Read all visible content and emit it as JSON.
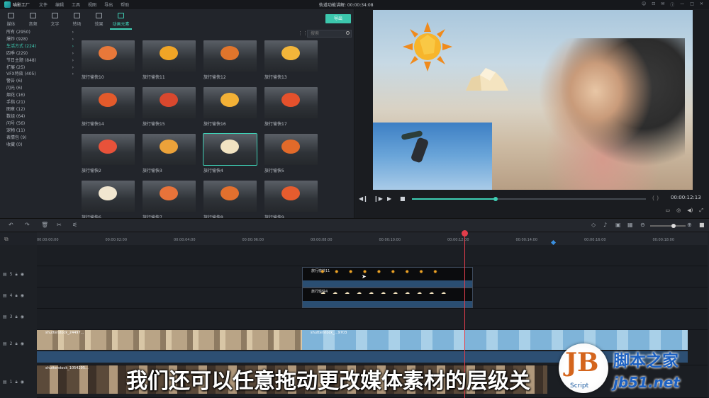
{
  "app": {
    "name": "喵影工厂",
    "title": "轨道功能讲解: 00:00:34:08"
  },
  "menu": [
    "文件",
    "编辑",
    "工具",
    "视图",
    "导出",
    "帮助"
  ],
  "media_tabs": [
    {
      "label": "媒体"
    },
    {
      "label": "音频"
    },
    {
      "label": "文字"
    },
    {
      "label": "转场"
    },
    {
      "label": "效果"
    },
    {
      "label": "动画元素"
    }
  ],
  "export_label": "导出",
  "search_placeholder": "搜索",
  "categories": [
    {
      "label": "所有 (2950)"
    },
    {
      "label": "爆炸 (928)"
    },
    {
      "label": "生活方式 (224)"
    },
    {
      "label": "四季 (229)"
    },
    {
      "label": "节日主题 (848)"
    },
    {
      "label": "扩展 (25)"
    },
    {
      "label": "VFX特效 (405)"
    },
    {
      "label": "警告 (6)"
    },
    {
      "label": "闪光 (6)"
    },
    {
      "label": "烟花 (16)"
    },
    {
      "label": "手指 (21)"
    },
    {
      "label": "图章 (12)"
    },
    {
      "label": "数组 (64)"
    },
    {
      "label": "问号 (56)"
    },
    {
      "label": "宠物 (11)"
    },
    {
      "label": "表情包 (9)"
    },
    {
      "label": "收藏 (0)"
    }
  ],
  "thumbnails": [
    {
      "label": "旅行愉快10",
      "color": "#e8783a"
    },
    {
      "label": "旅行愉快11",
      "color": "#f0a526"
    },
    {
      "label": "旅行愉快12",
      "color": "#e0752c"
    },
    {
      "label": "旅行愉快13",
      "color": "#f2b53a"
    },
    {
      "label": "旅行愉快14",
      "color": "#e35a2b"
    },
    {
      "label": "旅行愉快15",
      "color": "#d9482e"
    },
    {
      "label": "旅行愉快16",
      "color": "#f3b136"
    },
    {
      "label": "旅行愉快17",
      "color": "#e5512c"
    },
    {
      "label": "旅行愉快2",
      "color": "#e8523a"
    },
    {
      "label": "旅行愉快3",
      "color": "#eca23a"
    },
    {
      "label": "旅行愉快4",
      "color": "#f1e3c2"
    },
    {
      "label": "旅行愉快5",
      "color": "#e26a2a"
    },
    {
      "label": "旅行愉快6",
      "color": "#f1e6d0"
    },
    {
      "label": "旅行愉快7",
      "color": "#e8733a"
    },
    {
      "label": "旅行愉快8",
      "color": "#e3702e"
    },
    {
      "label": "旅行愉快9",
      "color": "#e65c2e"
    }
  ],
  "preview": {
    "timecode": "00:00:12:13"
  },
  "ruler_ticks": [
    "00:00:00:00",
    "00:00:02:00",
    "00:00:04:00",
    "00:00:06:00",
    "00:00:08:00",
    "00:00:10:00",
    "00:00:12:00",
    "00:00:14:00",
    "00:00:16:00",
    "00:00:18:00"
  ],
  "tracks": [
    {
      "id": "5"
    },
    {
      "id": "4"
    },
    {
      "id": "3"
    },
    {
      "id": "2"
    },
    {
      "id": "1"
    }
  ],
  "clips": {
    "fx_sun": "旅行愉快11",
    "fx_cloud": "旅行愉快4",
    "video_a": "shutterstock_24497...",
    "video_b": "shutterstock_...9703",
    "video_c": "shutterstock_1054295..."
  },
  "subtitle": "我们还可以任意拖动更改媒体素材的层级关",
  "watermark": {
    "badge": "JB",
    "badge_sub": "Script",
    "line1": "脚本之家",
    "line2": "jb51.net"
  }
}
